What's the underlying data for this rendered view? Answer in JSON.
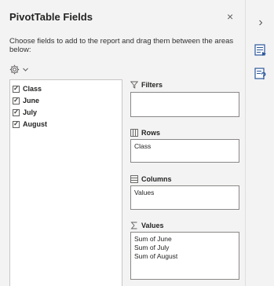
{
  "pane": {
    "title": "PivotTable Fields",
    "close_label": "×",
    "description": "Choose fields to add to the report and drag them between the areas below:"
  },
  "fields": [
    {
      "label": "Class",
      "checked": true
    },
    {
      "label": "June",
      "checked": true
    },
    {
      "label": "July",
      "checked": true
    },
    {
      "label": "August",
      "checked": true
    }
  ],
  "areas": {
    "filters": {
      "label": "Filters",
      "items": []
    },
    "rows": {
      "label": "Rows",
      "items": [
        "Class"
      ]
    },
    "columns": {
      "label": "Columns",
      "items": [
        "Values"
      ]
    },
    "values": {
      "label": "Values",
      "items": [
        "Sum of June",
        "Sum of July",
        "Sum of August"
      ]
    }
  },
  "rail": {
    "collapse_label": "›"
  },
  "icons": {
    "gear": "gear-icon",
    "filter": "filter-icon",
    "rows": "rows-icon",
    "columns": "columns-icon",
    "values": "sigma-icon",
    "field_list": "field-list-icon",
    "help": "help-icon"
  },
  "colors": {
    "accent": "#2b579a",
    "pane_bg": "#f3f3f3",
    "border": "#8a8886"
  }
}
